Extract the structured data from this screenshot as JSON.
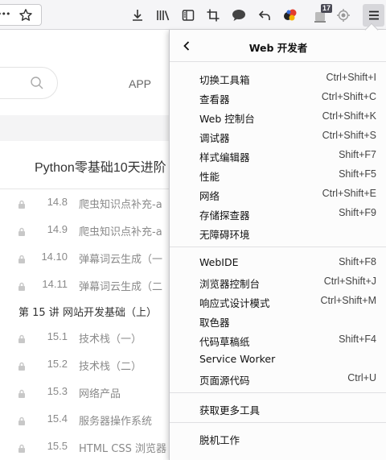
{
  "toolbar": {
    "ellipsis": "•••",
    "badge_count": "17",
    "icons": [
      "star-icon",
      "download-icon",
      "library-icon",
      "sidebar-icon",
      "screenshot-icon",
      "chat-icon",
      "undo-icon",
      "colorful-addon-icon",
      "addon-badge-icon",
      "target-icon",
      "hamburger-menu-icon"
    ]
  },
  "page": {
    "nav_app": "APP",
    "course_title": "Python零基础10天进阶",
    "lessons_a": [
      {
        "num": "14.8",
        "name": "爬虫知识点补充-a"
      },
      {
        "num": "14.9",
        "name": "爬虫知识点补充-a"
      },
      {
        "num": "14.10",
        "name": "弹幕词云生成（一"
      },
      {
        "num": "14.11",
        "name": "弹幕词云生成（二"
      }
    ],
    "section_15": "第 15 讲 网站开发基础（上）",
    "lessons_b": [
      {
        "num": "15.1",
        "name": "技术栈（一）"
      },
      {
        "num": "15.2",
        "name": "技术栈（二）"
      },
      {
        "num": "15.3",
        "name": "网络产品"
      },
      {
        "num": "15.4",
        "name": "服务器操作系统"
      },
      {
        "num": "15.5",
        "name": "HTML CSS 浏览器"
      }
    ]
  },
  "panel": {
    "title": "Web 开发者",
    "group1": [
      {
        "label": "切换工具箱",
        "shortcut": "Ctrl+Shift+I"
      },
      {
        "label": "查看器",
        "shortcut": "Ctrl+Shift+C"
      },
      {
        "label": "Web 控制台",
        "shortcut": "Ctrl+Shift+K"
      },
      {
        "label": "调试器",
        "shortcut": "Ctrl+Shift+S"
      },
      {
        "label": "样式编辑器",
        "shortcut": "Shift+F7"
      },
      {
        "label": "性能",
        "shortcut": "Shift+F5"
      },
      {
        "label": "网络",
        "shortcut": "Ctrl+Shift+E"
      },
      {
        "label": "存储探查器",
        "shortcut": "Shift+F9"
      },
      {
        "label": "无障碍环境",
        "shortcut": ""
      }
    ],
    "group2": [
      {
        "label": "WebIDE",
        "shortcut": "Shift+F8"
      },
      {
        "label": "浏览器控制台",
        "shortcut": "Ctrl+Shift+J"
      },
      {
        "label": "响应式设计模式",
        "shortcut": "Ctrl+Shift+M"
      },
      {
        "label": "取色器",
        "shortcut": ""
      },
      {
        "label": "代码草稿纸",
        "shortcut": "Shift+F4"
      },
      {
        "label": "Service Worker",
        "shortcut": ""
      },
      {
        "label": "页面源代码",
        "shortcut": "Ctrl+U"
      }
    ],
    "group3": [
      {
        "label": "获取更多工具",
        "shortcut": ""
      }
    ],
    "group4": [
      {
        "label": "脱机工作",
        "shortcut": ""
      }
    ]
  }
}
